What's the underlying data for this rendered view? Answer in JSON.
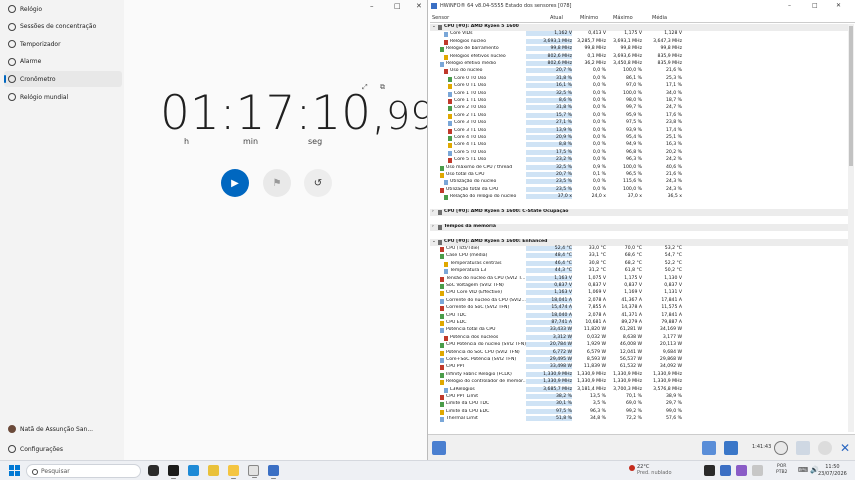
{
  "clock": {
    "nav": [
      {
        "label": "Relógio",
        "icon": "clock-icon",
        "active": false
      },
      {
        "label": "Sessões de concentração",
        "icon": "focus-icon",
        "active": false
      },
      {
        "label": "Temporizador",
        "icon": "hourglass-icon",
        "active": false
      },
      {
        "label": "Alarme",
        "icon": "alarm-icon",
        "active": false
      },
      {
        "label": "Cronômetro",
        "icon": "stopwatch-icon",
        "active": true
      },
      {
        "label": "Relógio mundial",
        "icon": "globe-icon",
        "active": false
      }
    ],
    "user": "Natã de Assunção San...",
    "settings": "Configurações",
    "time_main": "01:17:10,",
    "time_cs": "99",
    "labels": {
      "h": "h",
      "min": "min",
      "seg": "seg"
    },
    "window_controls": [
      "–",
      "□",
      "✕"
    ]
  },
  "hwinfo": {
    "title": "HWiNFO® 64 v8.04-5555 Estado dos sensores [078]",
    "columns": {
      "sensor": "Sensor",
      "current": "Atual",
      "min": "Mínimo",
      "max": "Máximo",
      "avg": "Média"
    },
    "rows": [
      {
        "type": "group",
        "name": "CPU [#0]: AMD Ryzen 5 1600"
      },
      {
        "name": "Core VIDs",
        "cur": "1,162 V",
        "min": "0,413 V",
        "max": "1,175 V",
        "avg": "1,128 V",
        "indent": 2
      },
      {
        "name": "Relógios núcleo",
        "cur": "3,693,1 MHz",
        "min": "3,285,7 MHz",
        "max": "3,693,1 MHz",
        "avg": "3,647,3 MHz",
        "indent": 2
      },
      {
        "name": "Relógio de barramento",
        "cur": "99,8 MHz",
        "min": "99,8 MHz",
        "max": "99,8 MHz",
        "avg": "99,8 MHz",
        "indent": 1
      },
      {
        "name": "Relógios efetivos núcleo",
        "cur": "802,6 MHz",
        "min": "0,1 MHz",
        "max": "3,693,6 MHz",
        "avg": "835,9 MHz",
        "indent": 2
      },
      {
        "name": "Relógio efetivo médio",
        "cur": "802,6 MHz",
        "min": "36,2 MHz",
        "max": "3,450,8 MHz",
        "avg": "835,9 MHz",
        "indent": 1
      },
      {
        "name": "Uso do núcleo",
        "cur": "20,7 %",
        "min": "0,0 %",
        "max": "100,0 %",
        "avg": "21,6 %",
        "indent": 2
      },
      {
        "name": "Core 0 T0 Uso",
        "cur": "31,8 %",
        "min": "0,0 %",
        "max": "86,1 %",
        "avg": "25,3 %",
        "indent": 3
      },
      {
        "name": "Core 0 T1 Uso",
        "cur": "16,1 %",
        "min": "0,0 %",
        "max": "97,0 %",
        "avg": "17,1 %",
        "indent": 3
      },
      {
        "name": "Core 1 T0 Uso",
        "cur": "32,5 %",
        "min": "0,0 %",
        "max": "100,0 %",
        "avg": "34,0 %",
        "indent": 3
      },
      {
        "name": "Core 1 T1 Uso",
        "cur": "8,6 %",
        "min": "0,0 %",
        "max": "98,0 %",
        "avg": "18,7 %",
        "indent": 3
      },
      {
        "name": "Core 2 T0 Uso",
        "cur": "31,8 %",
        "min": "0,0 %",
        "max": "99,7 %",
        "avg": "24,7 %",
        "indent": 3
      },
      {
        "name": "Core 2 T1 Uso",
        "cur": "15,7 %",
        "min": "0,0 %",
        "max": "95,9 %",
        "avg": "17,6 %",
        "indent": 3
      },
      {
        "name": "Core 3 T0 Uso",
        "cur": "27,1 %",
        "min": "0,0 %",
        "max": "97,5 %",
        "avg": "23,8 %",
        "indent": 3
      },
      {
        "name": "Core 3 T1 Uso",
        "cur": "13,9 %",
        "min": "0,0 %",
        "max": "93,9 %",
        "avg": "17,4 %",
        "indent": 3
      },
      {
        "name": "Core 4 T0 Uso",
        "cur": "20,9 %",
        "min": "0,0 %",
        "max": "95,4 %",
        "avg": "25,1 %",
        "indent": 3
      },
      {
        "name": "Core 4 T1 Uso",
        "cur": "8,8 %",
        "min": "0,0 %",
        "max": "94,9 %",
        "avg": "16,3 %",
        "indent": 3
      },
      {
        "name": "Core 5 T0 Uso",
        "cur": "17,5 %",
        "min": "0,0 %",
        "max": "96,8 %",
        "avg": "20,2 %",
        "indent": 3
      },
      {
        "name": "Core 5 T1 Uso",
        "cur": "23,2 %",
        "min": "0,0 %",
        "max": "96,3 %",
        "avg": "24,2 %",
        "indent": 3
      },
      {
        "name": "Uso máximo de CPU / thread",
        "cur": "32,5 %",
        "min": "0,9 %",
        "max": "100,0 %",
        "avg": "40,6 %",
        "indent": 1
      },
      {
        "name": "Uso total da CPU",
        "cur": "20,7 %",
        "min": "0,1 %",
        "max": "96,5 %",
        "avg": "21,6 %",
        "indent": 1
      },
      {
        "name": "Utilização do núcleo",
        "cur": "23,5 %",
        "min": "0,0 %",
        "max": "115,6 %",
        "avg": "24,3 %",
        "indent": 2
      },
      {
        "name": "Utilização total da CPU",
        "cur": "23,5 %",
        "min": "0,0 %",
        "max": "100,0 %",
        "avg": "24,3 %",
        "indent": 1
      },
      {
        "name": "Relação do relógio do núcleo",
        "cur": "37,0 x",
        "min": "24,0 x",
        "max": "37,0 x",
        "avg": "36,5 x",
        "indent": 2
      },
      {
        "type": "spacer"
      },
      {
        "type": "group",
        "name": "CPU [#0]: AMD Ryzen 5 1600: C-State Ocupação",
        "collapsed": true
      },
      {
        "type": "spacer"
      },
      {
        "type": "group",
        "name": "Tempos da memória",
        "collapsed": true
      },
      {
        "type": "spacer"
      },
      {
        "type": "group",
        "name": "CPU [#0]: AMD Ryzen 5 1600: Enhanced"
      },
      {
        "name": "CPU (Tctl/Tdie)",
        "cur": "52,4 °C",
        "min": "33,0 °C",
        "max": "70,0 °C",
        "avg": "53,2 °C",
        "indent": 1
      },
      {
        "name": "Case CPU (média)",
        "cur": "48,4 °C",
        "min": "33,1 °C",
        "max": "68,6 °C",
        "avg": "54,7 °C",
        "indent": 1
      },
      {
        "name": "Temperaturas centrais",
        "cur": "46,4 °C",
        "min": "30,8 °C",
        "max": "68,2 °C",
        "avg": "52,2 °C",
        "indent": 2
      },
      {
        "name": "Temperatura L3",
        "cur": "44,3 °C",
        "min": "31,2 °C",
        "max": "61,8 °C",
        "avg": "50,2 °C",
        "indent": 2
      },
      {
        "name": "Tensão do núcleo da CPU (SVI2 T...",
        "cur": "1,163 V",
        "min": "1,075 V",
        "max": "1,175 V",
        "avg": "1,130 V",
        "indent": 1
      },
      {
        "name": "SoC Voltagem (SVI2 TFN)",
        "cur": "0,837 V",
        "min": "0,837 V",
        "max": "0,837 V",
        "avg": "0,837 V",
        "indent": 1
      },
      {
        "name": "CPU Core VID (Effective)",
        "cur": "1,163 V",
        "min": "1,069 V",
        "max": "1,169 V",
        "avg": "1,131 V",
        "indent": 1
      },
      {
        "name": "Corrente do núcleo da CPU (SVI2...",
        "cur": "18,041 A",
        "min": "2,078 A",
        "max": "41,367 A",
        "avg": "17,841 A",
        "indent": 1
      },
      {
        "name": "Corrente do SoC (SVI2 TFN)",
        "cur": "15,474 A",
        "min": "7,855 A",
        "max": "14,378 A",
        "avg": "11,575 A",
        "indent": 1
      },
      {
        "name": "CPU TDC",
        "cur": "18,040 A",
        "min": "2,078 A",
        "max": "41,371 A",
        "avg": "17,841 A",
        "indent": 1
      },
      {
        "name": "CPU EDC",
        "cur": "87,741 A",
        "min": "10,681 A",
        "max": "89,279 A",
        "avg": "79,887 A",
        "indent": 1
      },
      {
        "name": "Potência total da CPU",
        "cur": "33,433 W",
        "min": "11,820 W",
        "max": "61,281 W",
        "avg": "34,169 W",
        "indent": 1
      },
      {
        "name": "Potência dos núcleos",
        "cur": "3,312 W",
        "min": "0,032 W",
        "max": "8,638 W",
        "avg": "3,177 W",
        "indent": 2
      },
      {
        "name": "CPU Potência do núcleo (SVI2 TFN)",
        "cur": "20,784 W",
        "min": "1,929 W",
        "max": "46,008 W",
        "avg": "20,113 W",
        "indent": 1
      },
      {
        "name": "Potência do SoC CPU (SVI2 TFN)",
        "cur": "6,772 W",
        "min": "6,579 W",
        "max": "12,041 W",
        "avg": "9,684 W",
        "indent": 1
      },
      {
        "name": "Core+SoC Potência (SVI2 TFN)",
        "cur": "29,495 W",
        "min": "8,593 W",
        "max": "56,537 W",
        "avg": "29,868 W",
        "indent": 1
      },
      {
        "name": "CPU PPT",
        "cur": "33,498 W",
        "min": "11,839 W",
        "max": "61,532 W",
        "avg": "34,092 W",
        "indent": 1
      },
      {
        "name": "Infinity Fabric Relógio (FCLK)",
        "cur": "1,330,9 MHz",
        "min": "1,330,9 MHz",
        "max": "1,330,9 MHz",
        "avg": "1,330,9 MHz",
        "indent": 1
      },
      {
        "name": "Relógio do controlador de memór...",
        "cur": "1,330,9 MHz",
        "min": "1,330,9 MHz",
        "max": "1,330,9 MHz",
        "avg": "1,330,9 MHz",
        "indent": 1
      },
      {
        "name": "L3Relógios",
        "cur": "3,685,7 MHz",
        "min": "3,181,4 MHz",
        "max": "3,700,3 MHz",
        "avg": "3,576,8 MHz",
        "indent": 2
      },
      {
        "name": "CPU PPT Limit",
        "cur": "38,2 %",
        "min": "13,5 %",
        "max": "70,1 %",
        "avg": "38,9 %",
        "indent": 1
      },
      {
        "name": "Limite da CPU TDC",
        "cur": "30,1 %",
        "min": "3,5 %",
        "max": "69,0 %",
        "avg": "29,7 %",
        "indent": 1
      },
      {
        "name": "Limite da CPU EDC",
        "cur": "97,5 %",
        "min": "96,3 %",
        "max": "99,2 %",
        "avg": "99,0 %",
        "indent": 1
      },
      {
        "name": "Thermal Limit",
        "cur": "51,8 %",
        "min": "34,8 %",
        "max": "72,2 %",
        "avg": "57,6 %",
        "indent": 1
      }
    ],
    "elapsed": "1:41:43"
  },
  "taskbar": {
    "search_placeholder": "Pesquisar",
    "weather_temp": "22°C",
    "weather_text": "Pred. nublado",
    "lang_top": "POR",
    "lang_bottom": "PTB2",
    "time": "11:50",
    "date": "23/07/2026"
  }
}
